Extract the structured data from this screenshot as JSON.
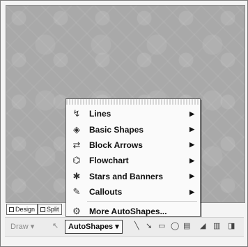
{
  "view_tabs": [
    {
      "label": "Design",
      "active": true,
      "icon": "design-view-icon"
    },
    {
      "label": "Split",
      "active": false,
      "icon": "split-view-icon"
    }
  ],
  "toolbar": {
    "draw_label": "Draw ▾",
    "autoshapes_label": "AutoShapes ▾",
    "tools": [
      {
        "icon": "select-objects-icon",
        "glyph": "↖"
      },
      {
        "icon": "line-icon",
        "glyph": "╲"
      },
      {
        "icon": "arrow-icon",
        "glyph": "↘"
      },
      {
        "icon": "rectangle-icon",
        "glyph": "▭"
      },
      {
        "icon": "oval-icon",
        "glyph": "◯"
      },
      {
        "icon": "text-box-icon",
        "glyph": "▤"
      },
      {
        "icon": "wordart-icon",
        "glyph": "◢"
      },
      {
        "icon": "diagram-icon",
        "glyph": "▥"
      },
      {
        "icon": "clip-art-icon",
        "glyph": "◨"
      }
    ]
  },
  "autoshapes_menu": {
    "items": [
      {
        "label": "Lines",
        "icon": "lines-icon",
        "glyph": "↯",
        "submenu": true
      },
      {
        "label": "Basic Shapes",
        "icon": "basic-shapes-icon",
        "glyph": "◈",
        "submenu": true
      },
      {
        "label": "Block Arrows",
        "icon": "block-arrows-icon",
        "glyph": "⇄",
        "submenu": true
      },
      {
        "label": "Flowchart",
        "icon": "flowchart-icon",
        "glyph": "⌬",
        "submenu": true
      },
      {
        "label": "Stars and Banners",
        "icon": "stars-banners-icon",
        "glyph": "✱",
        "submenu": true
      },
      {
        "label": "Callouts",
        "icon": "callouts-icon",
        "glyph": "✎",
        "submenu": true
      },
      {
        "label": "More AutoShapes...",
        "icon": "more-autoshapes-icon",
        "glyph": "⚙",
        "submenu": false
      }
    ]
  }
}
